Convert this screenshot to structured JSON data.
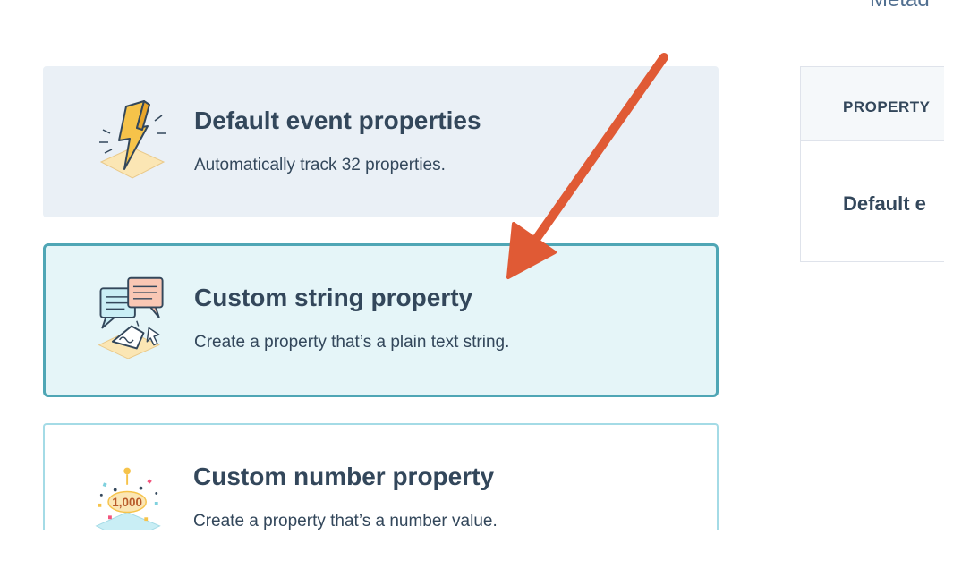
{
  "header": {
    "cut_text": "Metad"
  },
  "options": [
    {
      "id": "default",
      "title": "Default event properties",
      "description": "Automatically track 32 properties.",
      "icon": "lightning-bolt-icon"
    },
    {
      "id": "string",
      "title": "Custom string property",
      "description": "Create a property that’s a plain text string.",
      "icon": "chat-bubbles-icon"
    },
    {
      "id": "number",
      "title": "Custom number property",
      "description": "Create a property that’s a number value.",
      "icon": "confetti-number-icon",
      "icon_text": "1,000"
    }
  ],
  "table": {
    "header": "PROPERTY",
    "row_value": "Default e"
  },
  "colors": {
    "accent_border": "#4fa6b5",
    "selected_bg": "#e5f5f8",
    "default_bg": "#eaf0f6",
    "arrow": "#e05a35",
    "text": "#33475b"
  }
}
